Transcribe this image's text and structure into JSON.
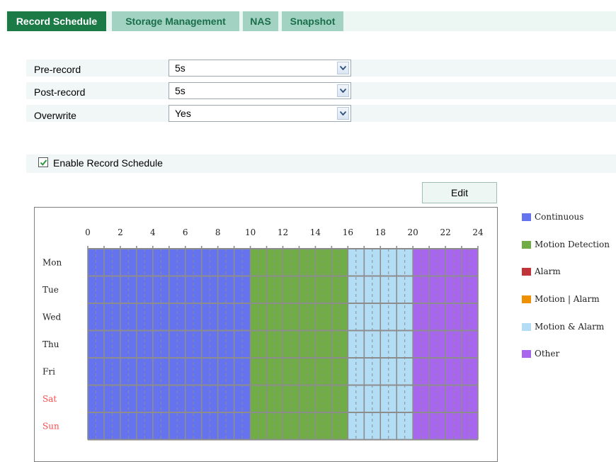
{
  "tabs": [
    {
      "label": "Record Schedule",
      "active": true
    },
    {
      "label": "Storage Management",
      "active": false
    },
    {
      "label": "NAS",
      "active": false
    },
    {
      "label": "Snapshot",
      "active": false
    }
  ],
  "settings": {
    "pre_record": {
      "label": "Pre-record",
      "value": "5s"
    },
    "post_record": {
      "label": "Post-record",
      "value": "5s"
    },
    "overwrite": {
      "label": "Overwrite",
      "value": "Yes"
    }
  },
  "enable_schedule": {
    "label": "Enable Record Schedule",
    "checked": true
  },
  "edit_button": {
    "label": "Edit"
  },
  "schedule": {
    "hour_ticks": [
      "0",
      "2",
      "4",
      "6",
      "8",
      "10",
      "12",
      "14",
      "16",
      "18",
      "20",
      "22",
      "24"
    ],
    "days": [
      {
        "label": "Mon",
        "weekend": false
      },
      {
        "label": "Tue",
        "weekend": false
      },
      {
        "label": "Wed",
        "weekend": false
      },
      {
        "label": "Thu",
        "weekend": false
      },
      {
        "label": "Fri",
        "weekend": false
      },
      {
        "label": "Sat",
        "weekend": true
      },
      {
        "label": "Sun",
        "weekend": true
      }
    ],
    "segments": [
      {
        "type": "Continuous",
        "start": 0,
        "end": 10
      },
      {
        "type": "Motion Detection",
        "start": 10,
        "end": 16
      },
      {
        "type": "Motion & Alarm",
        "start": 16,
        "end": 20
      },
      {
        "type": "Other",
        "start": 20,
        "end": 24
      }
    ],
    "weekend_color": "#ff4b4b"
  },
  "legend": [
    {
      "label": "Continuous",
      "color": "#6673ee"
    },
    {
      "label": "Motion Detection",
      "color": "#71ad47"
    },
    {
      "label": "Alarm",
      "color": "#c0343a"
    },
    {
      "label": "Motion | Alarm",
      "color": "#ef9000"
    },
    {
      "label": "Motion & Alarm",
      "color": "#b3dcf5"
    },
    {
      "label": "Other",
      "color": "#a865ee"
    }
  ]
}
